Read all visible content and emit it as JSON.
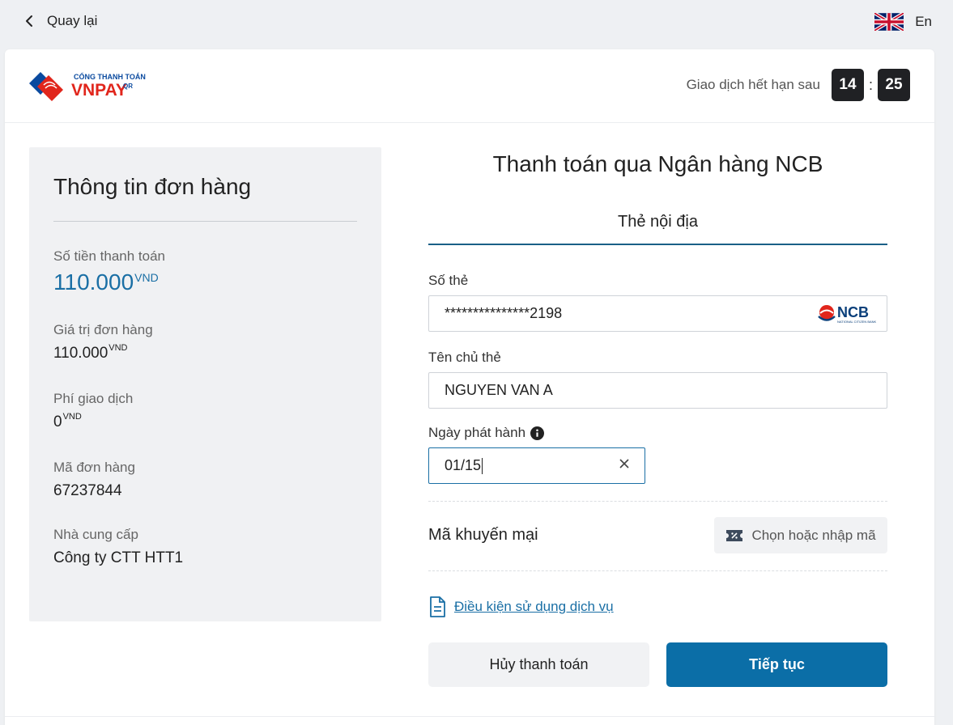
{
  "topbar": {
    "back_label": "Quay lại",
    "lang_label": "En"
  },
  "header": {
    "logo_top": "CỔNG THANH TOÁN",
    "logo_main": "VNPAY",
    "logo_sup": "QR",
    "expiry_label": "Giao dịch hết hạn sau",
    "minutes": "14",
    "colon": ":",
    "seconds": "25"
  },
  "order": {
    "title": "Thông tin đơn hàng",
    "amount_label": "Số tiền thanh toán",
    "amount_value": "110.000",
    "amount_unit": "VND",
    "order_value_label": "Giá trị đơn hàng",
    "order_value": "110.000",
    "order_value_unit": "VND",
    "fee_label": "Phí giao dịch",
    "fee_value": "0",
    "fee_unit": "VND",
    "order_id_label": "Mã đơn hàng",
    "order_id": "67237844",
    "provider_label": "Nhà cung cấp",
    "provider": "Công ty CTT HTT1"
  },
  "payment": {
    "title": "Thanh toán qua Ngân hàng NCB",
    "tab_domestic": "Thẻ nội địa",
    "card_number_label": "Số thẻ",
    "card_number_value": "***************2198",
    "bank_logo_text": "NCB",
    "bank_logo_sub": "NATIONAL CITIZEN BANK",
    "holder_label": "Tên chủ thẻ",
    "holder_value": "NGUYEN VAN A",
    "issue_date_label": "Ngày phát hành",
    "issue_date_value": "01/15",
    "promo_label": "Mã khuyến mại",
    "promo_button": "Chọn hoặc nhập mã",
    "terms_link": "Điều kiện sử dụng dịch vụ",
    "cancel_button": "Hủy thanh toán",
    "continue_button": "Tiếp tục"
  },
  "colors": {
    "accent": "#0b6ea7",
    "amount": "#1a6fa5",
    "timer_bg": "#202124"
  }
}
